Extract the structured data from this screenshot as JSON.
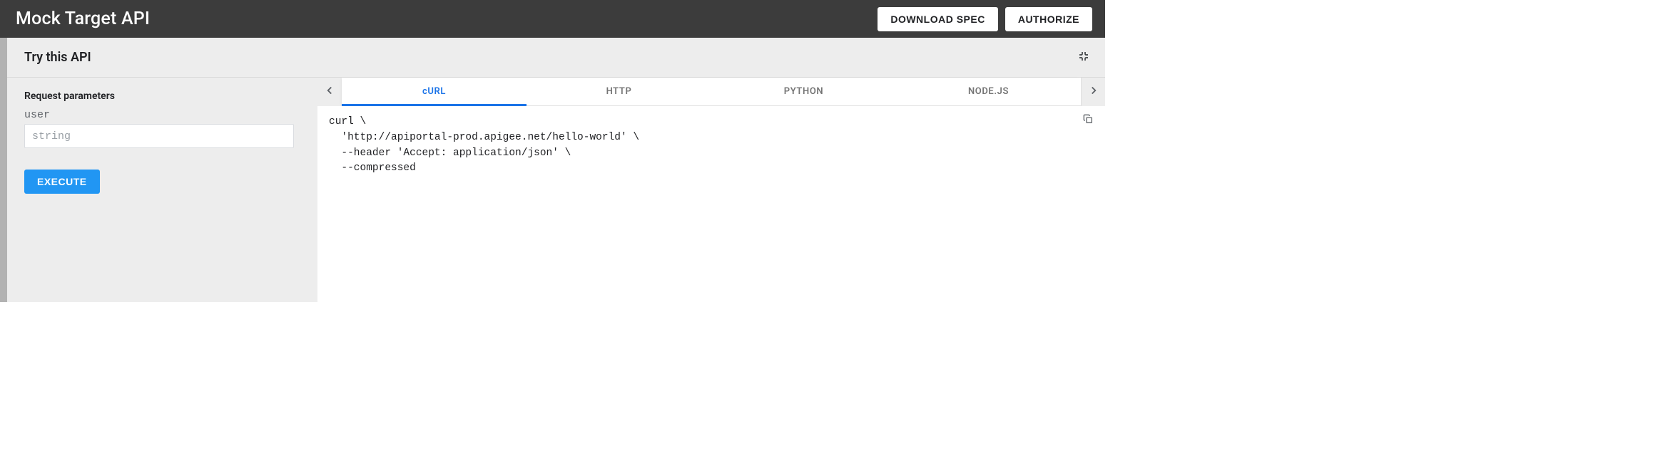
{
  "header": {
    "title": "Mock Target API",
    "download_label": "DOWNLOAD SPEC",
    "authorize_label": "AUTHORIZE"
  },
  "panel": {
    "title": "Try this API"
  },
  "params": {
    "heading": "Request parameters",
    "items": [
      {
        "name": "user",
        "placeholder": "string",
        "value": ""
      }
    ],
    "execute_label": "EXECUTE"
  },
  "code": {
    "tabs": [
      "cURL",
      "HTTP",
      "PYTHON",
      "NODE.JS"
    ],
    "active_tab_index": 0,
    "snippet": "curl \\\n  'http://apiportal-prod.apigee.net/hello-world' \\\n  --header 'Accept: application/json' \\\n  --compressed"
  }
}
